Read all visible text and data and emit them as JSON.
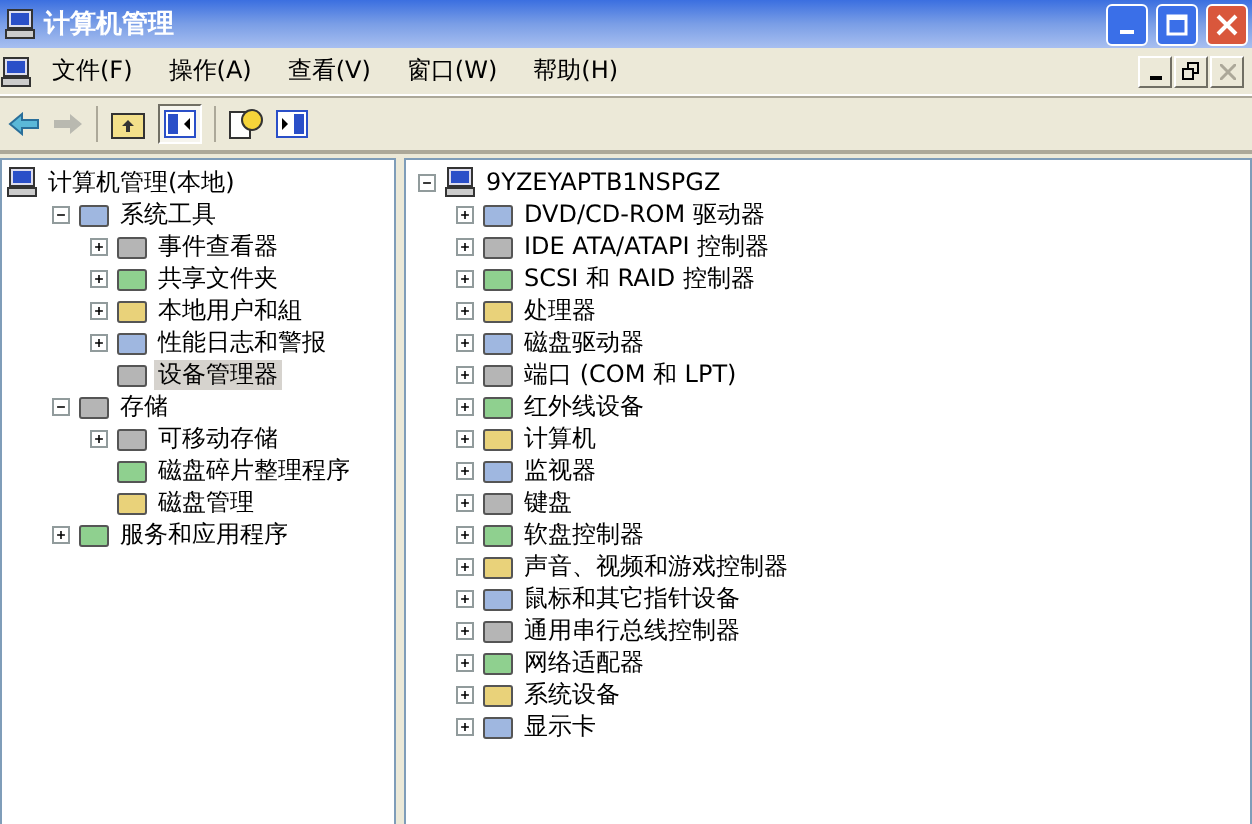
{
  "window": {
    "title": "计算机管理"
  },
  "menu": [
    "文件(F)",
    "操作(A)",
    "查看(V)",
    "窗口(W)",
    "帮助(H)"
  ],
  "left_tree": [
    {
      "label": "计算机管理(本地)",
      "selected": false,
      "children": [
        {
          "label": "系统工具",
          "selected": false,
          "expanded": true,
          "children": [
            {
              "label": "事件查看器",
              "selected": false,
              "expanded": false
            },
            {
              "label": "共享文件夹",
              "selected": false,
              "expanded": false
            },
            {
              "label": "本地用户和組",
              "selected": false,
              "expanded": false
            },
            {
              "label": "性能日志和警报",
              "selected": false,
              "expanded": false
            },
            {
              "label": "设备管理器",
              "selected": true
            }
          ]
        },
        {
          "label": "存储",
          "selected": false,
          "expanded": true,
          "children": [
            {
              "label": "可移动存储",
              "selected": false,
              "expanded": false
            },
            {
              "label": "磁盘碎片整理程序",
              "selected": false
            },
            {
              "label": "磁盘管理",
              "selected": false
            }
          ]
        },
        {
          "label": "服务和应用程序",
          "selected": false,
          "expanded": false
        }
      ]
    }
  ],
  "right_tree": [
    {
      "label": "9YZEYAPTB1NSPGZ",
      "expanded": true,
      "children": [
        {
          "label": "DVD/CD-ROM 驱动器",
          "expanded": false
        },
        {
          "label": "IDE ATA/ATAPI 控制器",
          "expanded": false
        },
        {
          "label": "SCSI 和 RAID 控制器",
          "expanded": false
        },
        {
          "label": "处理器",
          "expanded": false
        },
        {
          "label": "磁盘驱动器",
          "expanded": false
        },
        {
          "label": "端口 (COM 和 LPT)",
          "expanded": false
        },
        {
          "label": "红外线设备",
          "expanded": false
        },
        {
          "label": "计算机",
          "expanded": false
        },
        {
          "label": "监视器",
          "expanded": false
        },
        {
          "label": "键盘",
          "expanded": false
        },
        {
          "label": "软盘控制器",
          "expanded": false
        },
        {
          "label": "声音、视频和游戏控制器",
          "expanded": false
        },
        {
          "label": "鼠标和其它指针设备",
          "expanded": false
        },
        {
          "label": "通用串行总线控制器",
          "expanded": false
        },
        {
          "label": "网络适配器",
          "expanded": false
        },
        {
          "label": "系统设备",
          "expanded": false
        },
        {
          "label": "显示卡",
          "expanded": false
        }
      ]
    }
  ]
}
